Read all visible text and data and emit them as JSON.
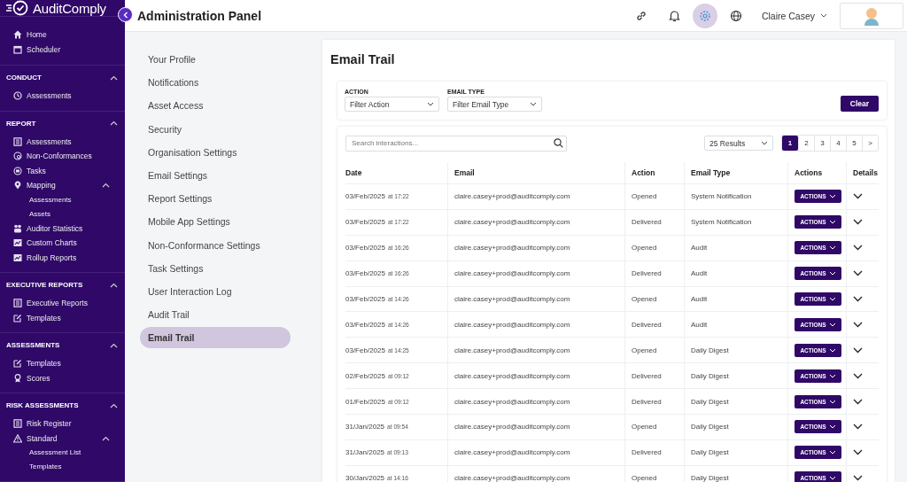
{
  "brand": "AuditComply",
  "page_title": "Administration Panel",
  "user": {
    "name": "Claire Casey"
  },
  "sidebar": [
    {
      "items": [
        {
          "label": "Home"
        },
        {
          "label": "Scheduler"
        }
      ]
    },
    {
      "header": "CONDUCT",
      "expanded": true,
      "items": [
        {
          "label": "Assessments"
        }
      ]
    },
    {
      "header": "REPORT",
      "expanded": true,
      "items": [
        {
          "label": "Assessments"
        },
        {
          "label": "Non-Conformances"
        },
        {
          "label": "Tasks"
        },
        {
          "label": "Mapping",
          "expanded": true,
          "children": [
            {
              "label": "Assessments"
            },
            {
              "label": "Assets"
            }
          ]
        },
        {
          "label": "Auditor Statistics"
        },
        {
          "label": "Custom Charts"
        },
        {
          "label": "Rollup Reports"
        }
      ]
    },
    {
      "header": "EXECUTIVE REPORTS",
      "expanded": true,
      "items": [
        {
          "label": "Executive Reports"
        },
        {
          "label": "Templates"
        }
      ]
    },
    {
      "header": "ASSESSMENTS",
      "expanded": true,
      "items": [
        {
          "label": "Templates"
        },
        {
          "label": "Scores"
        }
      ]
    },
    {
      "header": "RISK ASSESSMENTS",
      "expanded": true,
      "items": [
        {
          "label": "Risk Register"
        },
        {
          "label": "Standard",
          "expanded": true,
          "children": [
            {
              "label": "Assessment List"
            },
            {
              "label": "Templates"
            }
          ]
        }
      ]
    }
  ],
  "admin_nav": [
    {
      "label": "Your Profile",
      "selected": false
    },
    {
      "label": "Notifications",
      "selected": false
    },
    {
      "label": "Asset Access",
      "selected": false
    },
    {
      "label": "Security",
      "selected": false
    },
    {
      "label": "Organisation Settings",
      "selected": false
    },
    {
      "label": "Email Settings",
      "selected": false
    },
    {
      "label": "Report Settings",
      "selected": false
    },
    {
      "label": "Mobile App Settings",
      "selected": false
    },
    {
      "label": "Non-Conformance Settings",
      "selected": false
    },
    {
      "label": "Task Settings",
      "selected": false
    },
    {
      "label": "User Interaction Log",
      "selected": false
    },
    {
      "label": "Audit Trail",
      "selected": false
    },
    {
      "label": "Email Trail",
      "selected": true
    }
  ],
  "panel_title": "Email Trail",
  "filters": [
    {
      "label": "ACTION",
      "value": "Filter Action"
    },
    {
      "label": "EMAIL TYPE",
      "value": "Filter Email Type"
    }
  ],
  "clear_button": "Clear",
  "search": {
    "placeholder": "Search interactions..."
  },
  "results": "25 Results",
  "pagination": [
    {
      "label": "1",
      "selected": true
    },
    {
      "label": "2",
      "selected": false
    },
    {
      "label": "3",
      "selected": false
    },
    {
      "label": "4",
      "selected": false
    },
    {
      "label": "5",
      "selected": false
    },
    {
      "label": ">",
      "selected": false
    }
  ],
  "table": {
    "columns": [
      "Date",
      "Email",
      "Action",
      "Email Type",
      "Actions",
      "Details"
    ],
    "rows": [
      {
        "date": "03/Feb/2025",
        "time": "at 17:22",
        "email": "claire.casey+prod@auditcomply.com",
        "action": "Opened",
        "email_type": "System Notification",
        "button": "ACTIONS"
      },
      {
        "date": "03/Feb/2025",
        "time": "at 17:22",
        "email": "claire.casey+prod@auditcomply.com",
        "action": "Delivered",
        "email_type": "System Notification",
        "button": "ACTIONS"
      },
      {
        "date": "03/Feb/2025",
        "time": "at 16:26",
        "email": "claire.casey+prod@auditcomply.com",
        "action": "Opened",
        "email_type": "Audit",
        "button": "ACTIONS"
      },
      {
        "date": "03/Feb/2025",
        "time": "at 16:26",
        "email": "claire.casey+prod@auditcomply.com",
        "action": "Delivered",
        "email_type": "Audit",
        "button": "ACTIONS"
      },
      {
        "date": "03/Feb/2025",
        "time": "at 14:26",
        "email": "claire.casey+prod@auditcomply.com",
        "action": "Opened",
        "email_type": "Audit",
        "button": "ACTIONS"
      },
      {
        "date": "03/Feb/2025",
        "time": "at 14:26",
        "email": "claire.casey+prod@auditcomply.com",
        "action": "Delivered",
        "email_type": "Audit",
        "button": "ACTIONS"
      },
      {
        "date": "03/Feb/2025",
        "time": "at 14:25",
        "email": "claire.casey+prod@auditcomply.com",
        "action": "Opened",
        "email_type": "Daily Digest",
        "button": "ACTIONS"
      },
      {
        "date": "02/Feb/2025",
        "time": "at 09:12",
        "email": "claire.casey+prod@auditcomply.com",
        "action": "Delivered",
        "email_type": "Daily Digest",
        "button": "ACTIONS"
      },
      {
        "date": "01/Feb/2025",
        "time": "at 09:12",
        "email": "claire.casey+prod@auditcomply.com",
        "action": "Delivered",
        "email_type": "Daily Digest",
        "button": "ACTIONS"
      },
      {
        "date": "31/Jan/2025",
        "time": "at 09:54",
        "email": "claire.casey+prod@auditcomply.com",
        "action": "Opened",
        "email_type": "Daily Digest",
        "button": "ACTIONS"
      },
      {
        "date": "31/Jan/2025",
        "time": "at 09:13",
        "email": "claire.casey+prod@auditcomply.com",
        "action": "Delivered",
        "email_type": "Daily Digest",
        "button": "ACTIONS"
      },
      {
        "date": "30/Jan/2025",
        "time": "at 14:16",
        "email": "claire.casey+prod@auditcomply.com",
        "action": "Opened",
        "email_type": "Daily Digest",
        "button": "ACTIONS"
      }
    ]
  }
}
